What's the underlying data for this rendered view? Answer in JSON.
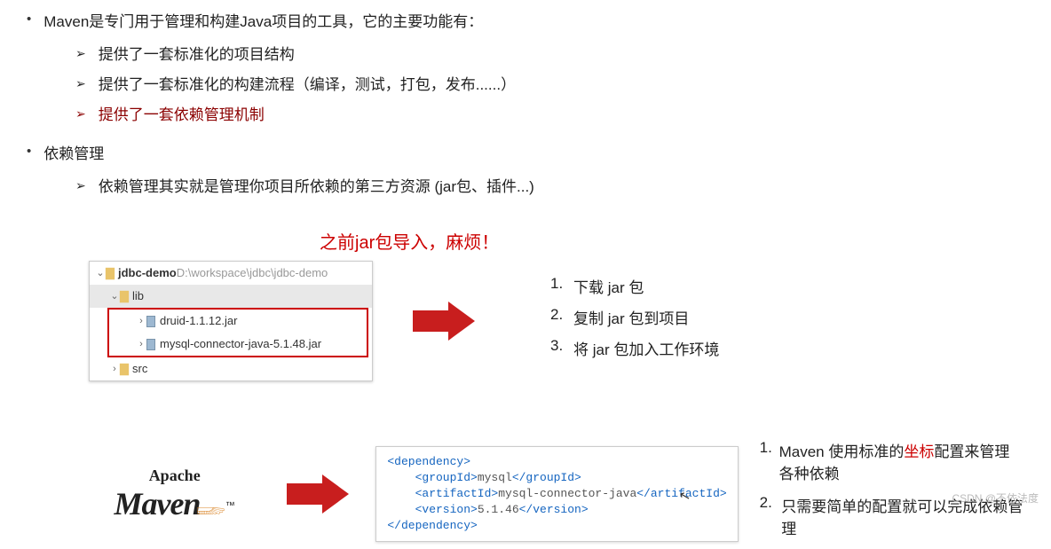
{
  "intro": {
    "heading": "Maven是专门用于管理和构建Java项目的工具，它的主要功能有：",
    "items": [
      "提供了一套标准化的项目结构",
      "提供了一套标准化的构建流程（编译，测试，打包，发布......）",
      "提供了一套依赖管理机制"
    ]
  },
  "dep": {
    "heading": "依赖管理",
    "desc": "依赖管理其实就是管理你项目所依赖的第三方资源 (jar包、插件...)"
  },
  "jar_title": "之前jar包导入，麻烦！",
  "tree": {
    "project": "jdbc-demo",
    "path": " D:\\workspace\\jdbc\\jdbc-demo",
    "lib": "lib",
    "jar1": "druid-1.1.12.jar",
    "jar2": "mysql-connector-java-5.1.48.jar",
    "src": "src"
  },
  "steps": [
    "下载 jar 包",
    "复制 jar 包到项目",
    "将 jar 包加入工作环境"
  ],
  "maven_logo": {
    "top": "Apache",
    "main": "Maven",
    "tm": "™"
  },
  "xml": {
    "open_dep": "<dependency>",
    "gid_o": "<groupId>",
    "gid_t": "mysql",
    "gid_c": "</groupId>",
    "aid_o": "<artifactId>",
    "aid_t": "mysql-connector-java",
    "aid_c": "</artifactId>",
    "ver_o": "<version>",
    "ver_t": "5.1.46",
    "ver_c": "</version>",
    "close_dep": "</dependency>"
  },
  "benefits": {
    "b1_pre": "Maven 使用标准的",
    "b1_coord": "坐标",
    "b1_post": "配置来管理各种依赖",
    "b2": "只需要简单的配置就可以完成依赖管理"
  },
  "watermark": "CSDN @不依法度"
}
